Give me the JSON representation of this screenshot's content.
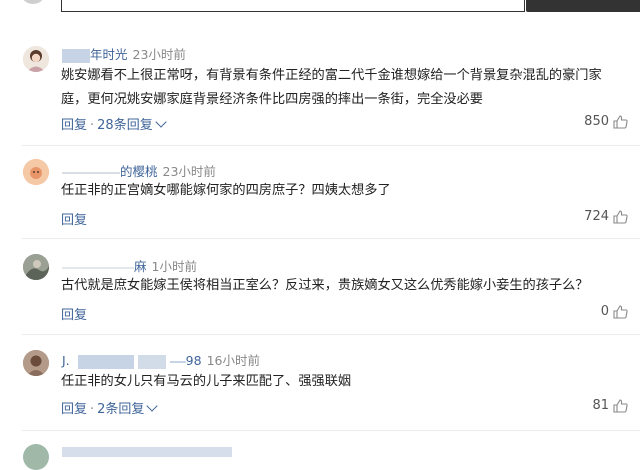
{
  "comments": [
    {
      "username": "年时光",
      "time": "23小时前",
      "content": "姚安娜看不上很正常呀，有背景有条件正经的富二代千金谁想嫁给一个背景复杂混乱的豪门家庭，更何况姚安娜家庭背景经济条件比四房强的摔出一条街，完全没必要",
      "reply_label": "回复",
      "reply_count_label": "28条回复",
      "likes": "850"
    },
    {
      "username": "的樱桃",
      "time": "23小时前",
      "content": "任正非的正宫嫡女哪能嫁何家的四房庶子？四姨太想多了",
      "reply_label": "回复",
      "likes": "724"
    },
    {
      "username": "麻",
      "time": "1小时前",
      "content": "古代就是庶女能嫁王侯将相当正室么？反过来，贵族嫡女又这么优秀能嫁小妾生的孩子么？",
      "reply_label": "回复",
      "likes": "0"
    },
    {
      "username_prefix": "J.",
      "username": "98",
      "time": "16小时前",
      "content": "任正非的女儿只有马云的儿子来匹配了、强强联姻",
      "reply_label": "回复",
      "reply_count_label": "2条回复",
      "likes": "81"
    }
  ],
  "colors": {
    "link": "#406599",
    "meta": "#888888",
    "text": "#222222"
  },
  "icons": {
    "like": "thumbs-up-icon",
    "more": "chevron-down-icon"
  }
}
